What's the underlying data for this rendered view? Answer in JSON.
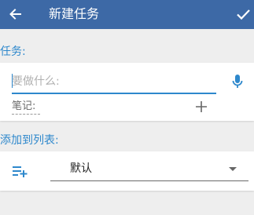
{
  "toolbar": {
    "title": "新建任务",
    "back_icon": "arrow-back-icon",
    "done_icon": "check-icon",
    "background": "#3d69a6"
  },
  "task_section": {
    "label": "任务:",
    "input_placeholder": "要做什么:",
    "input_value": "",
    "notes_label": "笔记:",
    "mic_icon": "microphone-icon",
    "add_note_icon": "plus-icon"
  },
  "list_section": {
    "label": "添加到列表:",
    "selected_list": "默认",
    "list_icon": "playlist-add-icon",
    "dropdown_icon": "dropdown-arrow-icon"
  },
  "colors": {
    "accent": "#2e88cc",
    "page_background": "#eeeeee"
  }
}
